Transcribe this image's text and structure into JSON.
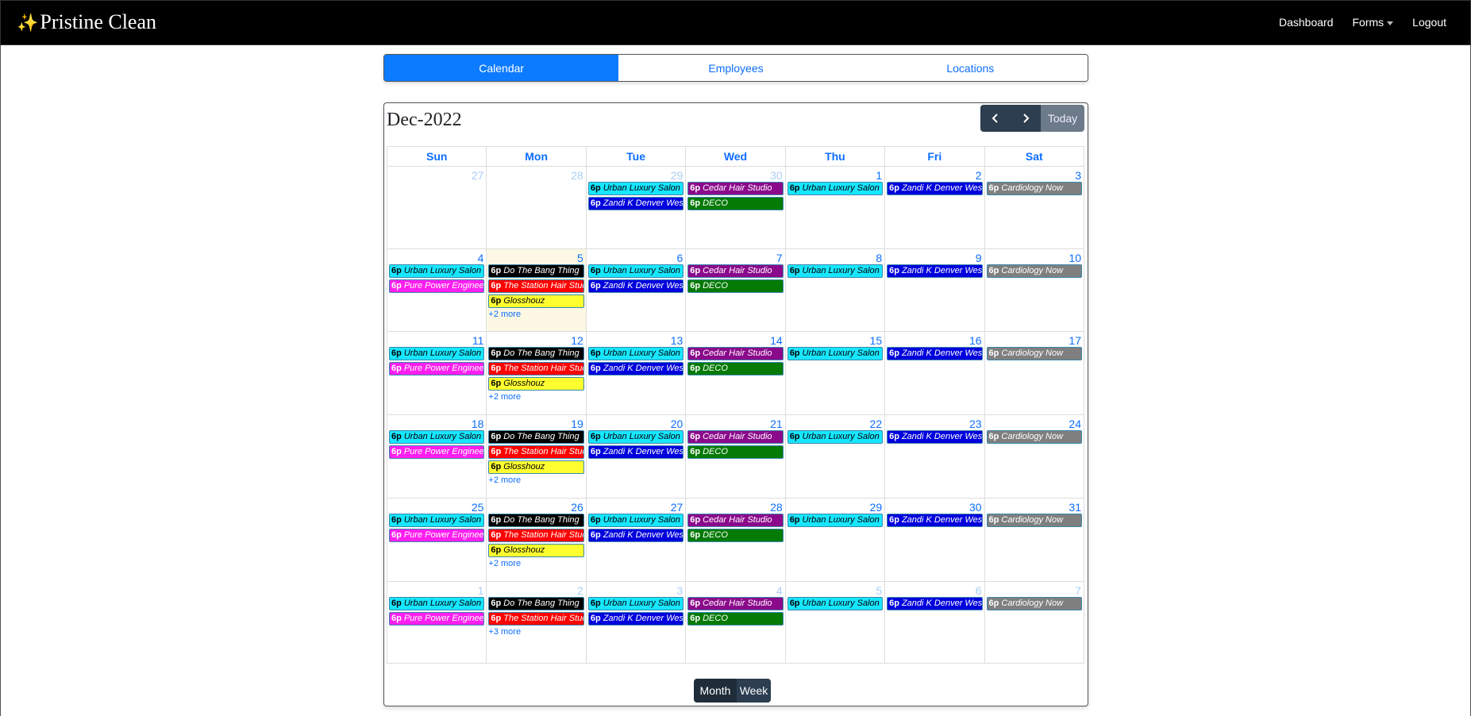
{
  "navbar": {
    "spark": "✨",
    "brand": "Pristine Clean",
    "links": {
      "dashboard": "Dashboard",
      "forms": "Forms",
      "logout": "Logout"
    }
  },
  "tabs": [
    "Calendar",
    "Employees",
    "Locations"
  ],
  "calendar": {
    "title": "Dec-2022",
    "prev_icon": "chevron-left-icon",
    "next_icon": "chevron-right-icon",
    "today_label": "Today",
    "days": [
      "Sun",
      "Mon",
      "Tue",
      "Wed",
      "Thu",
      "Fri",
      "Sat"
    ],
    "views": {
      "month": "Month",
      "week": "Week"
    },
    "styles": {
      "urban": {
        "bg": "#17e6ff",
        "fg": "#000000",
        "border": "#3a87ad"
      },
      "zandi": {
        "bg": "#0000dd",
        "fg": "#ffffff",
        "border": "#3a87ad"
      },
      "cedar": {
        "bg": "#8b0a8b",
        "fg": "#ffffff",
        "border": "#3a87ad"
      },
      "deco": {
        "bg": "#057a05",
        "fg": "#ffffff",
        "border": "#3a87ad"
      },
      "cardio": {
        "bg": "#7f7f7f",
        "fg": "#ffffff",
        "border": "#3a87ad"
      },
      "bang": {
        "bg": "#000000",
        "fg": "#ffffff",
        "border": "#3a87ad"
      },
      "station": {
        "bg": "#ff0000",
        "fg": "#ffffff",
        "border": "#3a87ad"
      },
      "gloss": {
        "bg": "#ffff30",
        "fg": "#000000",
        "border": "#3a87ad"
      },
      "pure": {
        "bg": "#ff1ef0",
        "fg": "#ffffff",
        "border": "#3a87ad"
      }
    },
    "weeks": [
      [
        {
          "day": "27",
          "other": true,
          "events": []
        },
        {
          "day": "28",
          "other": true,
          "events": []
        },
        {
          "day": "29",
          "other": true,
          "events": [
            {
              "time": "6p",
              "name": "Urban Luxury Salon",
              "style": "urban"
            },
            {
              "time": "6p",
              "name": "Zandi K Denver West",
              "style": "zandi"
            }
          ]
        },
        {
          "day": "30",
          "other": true,
          "events": [
            {
              "time": "6p",
              "name": "Cedar Hair Studio",
              "style": "cedar"
            },
            {
              "time": "6p",
              "name": "DECO",
              "style": "deco"
            }
          ]
        },
        {
          "day": "1",
          "events": [
            {
              "time": "6p",
              "name": "Urban Luxury Salon",
              "style": "urban"
            }
          ]
        },
        {
          "day": "2",
          "events": [
            {
              "time": "6p",
              "name": "Zandi K Denver West",
              "style": "zandi"
            }
          ]
        },
        {
          "day": "3",
          "events": [
            {
              "time": "6p",
              "name": "Cardiology Now",
              "style": "cardio"
            }
          ]
        }
      ],
      [
        {
          "day": "4",
          "events": [
            {
              "time": "6p",
              "name": "Urban Luxury Salon",
              "style": "urban"
            },
            {
              "time": "6p",
              "name": "Pure Power Engineering",
              "style": "pure"
            }
          ]
        },
        {
          "day": "5",
          "today": true,
          "events": [
            {
              "time": "6p",
              "name": "Do The Bang Thing",
              "style": "bang"
            },
            {
              "time": "6p",
              "name": "The Station Hair Studio",
              "style": "station"
            },
            {
              "time": "6p",
              "name": "Glosshouz",
              "style": "gloss"
            }
          ],
          "more": "+2 more"
        },
        {
          "day": "6",
          "events": [
            {
              "time": "6p",
              "name": "Urban Luxury Salon",
              "style": "urban"
            },
            {
              "time": "6p",
              "name": "Zandi K Denver West",
              "style": "zandi"
            }
          ]
        },
        {
          "day": "7",
          "events": [
            {
              "time": "6p",
              "name": "Cedar Hair Studio",
              "style": "cedar"
            },
            {
              "time": "6p",
              "name": "DECO",
              "style": "deco"
            }
          ]
        },
        {
          "day": "8",
          "events": [
            {
              "time": "6p",
              "name": "Urban Luxury Salon",
              "style": "urban"
            }
          ]
        },
        {
          "day": "9",
          "events": [
            {
              "time": "6p",
              "name": "Zandi K Denver West",
              "style": "zandi"
            }
          ]
        },
        {
          "day": "10",
          "events": [
            {
              "time": "6p",
              "name": "Cardiology Now",
              "style": "cardio"
            }
          ]
        }
      ],
      [
        {
          "day": "11",
          "events": [
            {
              "time": "6p",
              "name": "Urban Luxury Salon",
              "style": "urban"
            },
            {
              "time": "6p",
              "name": "Pure Power Engineering",
              "style": "pure"
            }
          ]
        },
        {
          "day": "12",
          "events": [
            {
              "time": "6p",
              "name": "Do The Bang Thing",
              "style": "bang"
            },
            {
              "time": "6p",
              "name": "The Station Hair Studio",
              "style": "station"
            },
            {
              "time": "6p",
              "name": "Glosshouz",
              "style": "gloss"
            }
          ],
          "more": "+2 more"
        },
        {
          "day": "13",
          "events": [
            {
              "time": "6p",
              "name": "Urban Luxury Salon",
              "style": "urban"
            },
            {
              "time": "6p",
              "name": "Zandi K Denver West",
              "style": "zandi"
            }
          ]
        },
        {
          "day": "14",
          "events": [
            {
              "time": "6p",
              "name": "Cedar Hair Studio",
              "style": "cedar"
            },
            {
              "time": "6p",
              "name": "DECO",
              "style": "deco"
            }
          ]
        },
        {
          "day": "15",
          "events": [
            {
              "time": "6p",
              "name": "Urban Luxury Salon",
              "style": "urban"
            }
          ]
        },
        {
          "day": "16",
          "events": [
            {
              "time": "6p",
              "name": "Zandi K Denver West",
              "style": "zandi"
            }
          ]
        },
        {
          "day": "17",
          "events": [
            {
              "time": "6p",
              "name": "Cardiology Now",
              "style": "cardio"
            }
          ]
        }
      ],
      [
        {
          "day": "18",
          "events": [
            {
              "time": "6p",
              "name": "Urban Luxury Salon",
              "style": "urban"
            },
            {
              "time": "6p",
              "name": "Pure Power Engineering",
              "style": "pure"
            }
          ]
        },
        {
          "day": "19",
          "events": [
            {
              "time": "6p",
              "name": "Do The Bang Thing",
              "style": "bang"
            },
            {
              "time": "6p",
              "name": "The Station Hair Studio",
              "style": "station"
            },
            {
              "time": "6p",
              "name": "Glosshouz",
              "style": "gloss"
            }
          ],
          "more": "+2 more"
        },
        {
          "day": "20",
          "events": [
            {
              "time": "6p",
              "name": "Urban Luxury Salon",
              "style": "urban"
            },
            {
              "time": "6p",
              "name": "Zandi K Denver West",
              "style": "zandi"
            }
          ]
        },
        {
          "day": "21",
          "events": [
            {
              "time": "6p",
              "name": "Cedar Hair Studio",
              "style": "cedar"
            },
            {
              "time": "6p",
              "name": "DECO",
              "style": "deco"
            }
          ]
        },
        {
          "day": "22",
          "events": [
            {
              "time": "6p",
              "name": "Urban Luxury Salon",
              "style": "urban"
            }
          ]
        },
        {
          "day": "23",
          "events": [
            {
              "time": "6p",
              "name": "Zandi K Denver West",
              "style": "zandi"
            }
          ]
        },
        {
          "day": "24",
          "events": [
            {
              "time": "6p",
              "name": "Cardiology Now",
              "style": "cardio"
            }
          ]
        }
      ],
      [
        {
          "day": "25",
          "events": [
            {
              "time": "6p",
              "name": "Urban Luxury Salon",
              "style": "urban"
            },
            {
              "time": "6p",
              "name": "Pure Power Engineering",
              "style": "pure"
            }
          ]
        },
        {
          "day": "26",
          "events": [
            {
              "time": "6p",
              "name": "Do The Bang Thing",
              "style": "bang"
            },
            {
              "time": "6p",
              "name": "The Station Hair Studio",
              "style": "station"
            },
            {
              "time": "6p",
              "name": "Glosshouz",
              "style": "gloss"
            }
          ],
          "more": "+2 more"
        },
        {
          "day": "27",
          "events": [
            {
              "time": "6p",
              "name": "Urban Luxury Salon",
              "style": "urban"
            },
            {
              "time": "6p",
              "name": "Zandi K Denver West",
              "style": "zandi"
            }
          ]
        },
        {
          "day": "28",
          "events": [
            {
              "time": "6p",
              "name": "Cedar Hair Studio",
              "style": "cedar"
            },
            {
              "time": "6p",
              "name": "DECO",
              "style": "deco"
            }
          ]
        },
        {
          "day": "29",
          "events": [
            {
              "time": "6p",
              "name": "Urban Luxury Salon",
              "style": "urban"
            }
          ]
        },
        {
          "day": "30",
          "events": [
            {
              "time": "6p",
              "name": "Zandi K Denver West",
              "style": "zandi"
            }
          ]
        },
        {
          "day": "31",
          "events": [
            {
              "time": "6p",
              "name": "Cardiology Now",
              "style": "cardio"
            }
          ]
        }
      ],
      [
        {
          "day": "1",
          "other": true,
          "events": [
            {
              "time": "6p",
              "name": "Urban Luxury Salon",
              "style": "urban"
            },
            {
              "time": "6p",
              "name": "Pure Power Engineering",
              "style": "pure"
            }
          ]
        },
        {
          "day": "2",
          "other": true,
          "events": [
            {
              "time": "6p",
              "name": "Do The Bang Thing",
              "style": "bang"
            },
            {
              "time": "6p",
              "name": "The Station Hair Studio",
              "style": "station"
            }
          ],
          "more": "+3 more"
        },
        {
          "day": "3",
          "other": true,
          "events": [
            {
              "time": "6p",
              "name": "Urban Luxury Salon",
              "style": "urban"
            },
            {
              "time": "6p",
              "name": "Zandi K Denver West",
              "style": "zandi"
            }
          ]
        },
        {
          "day": "4",
          "other": true,
          "events": [
            {
              "time": "6p",
              "name": "Cedar Hair Studio",
              "style": "cedar"
            },
            {
              "time": "6p",
              "name": "DECO",
              "style": "deco"
            }
          ]
        },
        {
          "day": "5",
          "other": true,
          "events": [
            {
              "time": "6p",
              "name": "Urban Luxury Salon",
              "style": "urban"
            }
          ]
        },
        {
          "day": "6",
          "other": true,
          "events": [
            {
              "time": "6p",
              "name": "Zandi K Denver West",
              "style": "zandi"
            }
          ]
        },
        {
          "day": "7",
          "other": true,
          "events": [
            {
              "time": "6p",
              "name": "Cardiology Now",
              "style": "cardio"
            }
          ]
        }
      ]
    ]
  }
}
